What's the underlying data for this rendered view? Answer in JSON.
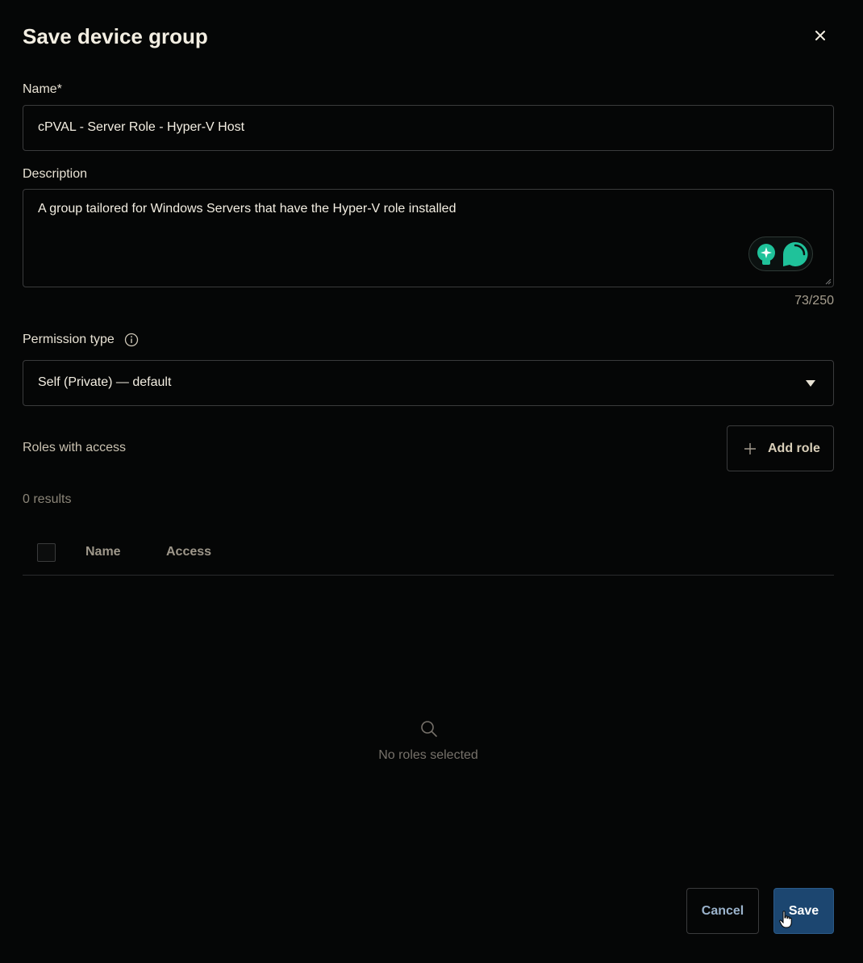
{
  "dialog": {
    "title": "Save device group",
    "close_icon": "close-icon"
  },
  "name_field": {
    "label": "Name*",
    "value": "cPVAL - Server Role - Hyper-V Host"
  },
  "description_field": {
    "label": "Description",
    "value": "A group tailored for Windows Servers that have the Hyper-V role installed",
    "char_count": "73/250"
  },
  "permission": {
    "label": "Permission type",
    "info_icon": "info-icon",
    "selected": "Self (Private) — default"
  },
  "roles": {
    "label": "Roles with access",
    "add_button": "Add role",
    "results": "0 results",
    "columns": [
      "Name",
      "Access"
    ],
    "empty_message": "No roles selected"
  },
  "footer": {
    "cancel": "Cancel",
    "save": "Save"
  },
  "colors": {
    "background": "#050606",
    "primary_button": "#1c4670",
    "assistant_accent": "#1fc29a"
  }
}
